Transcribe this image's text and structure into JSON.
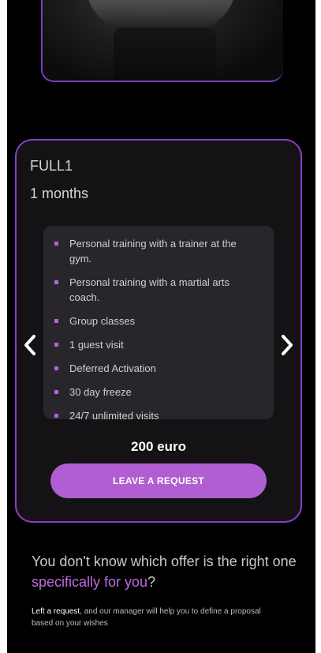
{
  "photo": {
    "next_label": ">"
  },
  "plan": {
    "name": "FULL1",
    "duration": "1 months",
    "features": [
      "Personal training with a trainer at the gym.",
      "Personal training with a martial arts coach.",
      "Group classes",
      "1 guest visit",
      "Deferred Activation",
      "30 day freeze",
      "24/7 unlimited visits"
    ],
    "price": "200 euro",
    "cta_label": "LEAVE A REQUEST"
  },
  "carousel": {
    "prev_icon": "chevron-left-icon",
    "next_icon": "chevron-right-icon"
  },
  "help": {
    "question_start": "You don't know which offer is the right one ",
    "question_accent": "specifically for you",
    "question_end": "?",
    "link_text": "Left a request",
    "rest_text": ", and our manager will help you to define a proposal based on your wishes"
  },
  "colors": {
    "background": "#000000",
    "accent": "#b05ed1",
    "card": "#141215",
    "features_bg": "#28262a"
  }
}
